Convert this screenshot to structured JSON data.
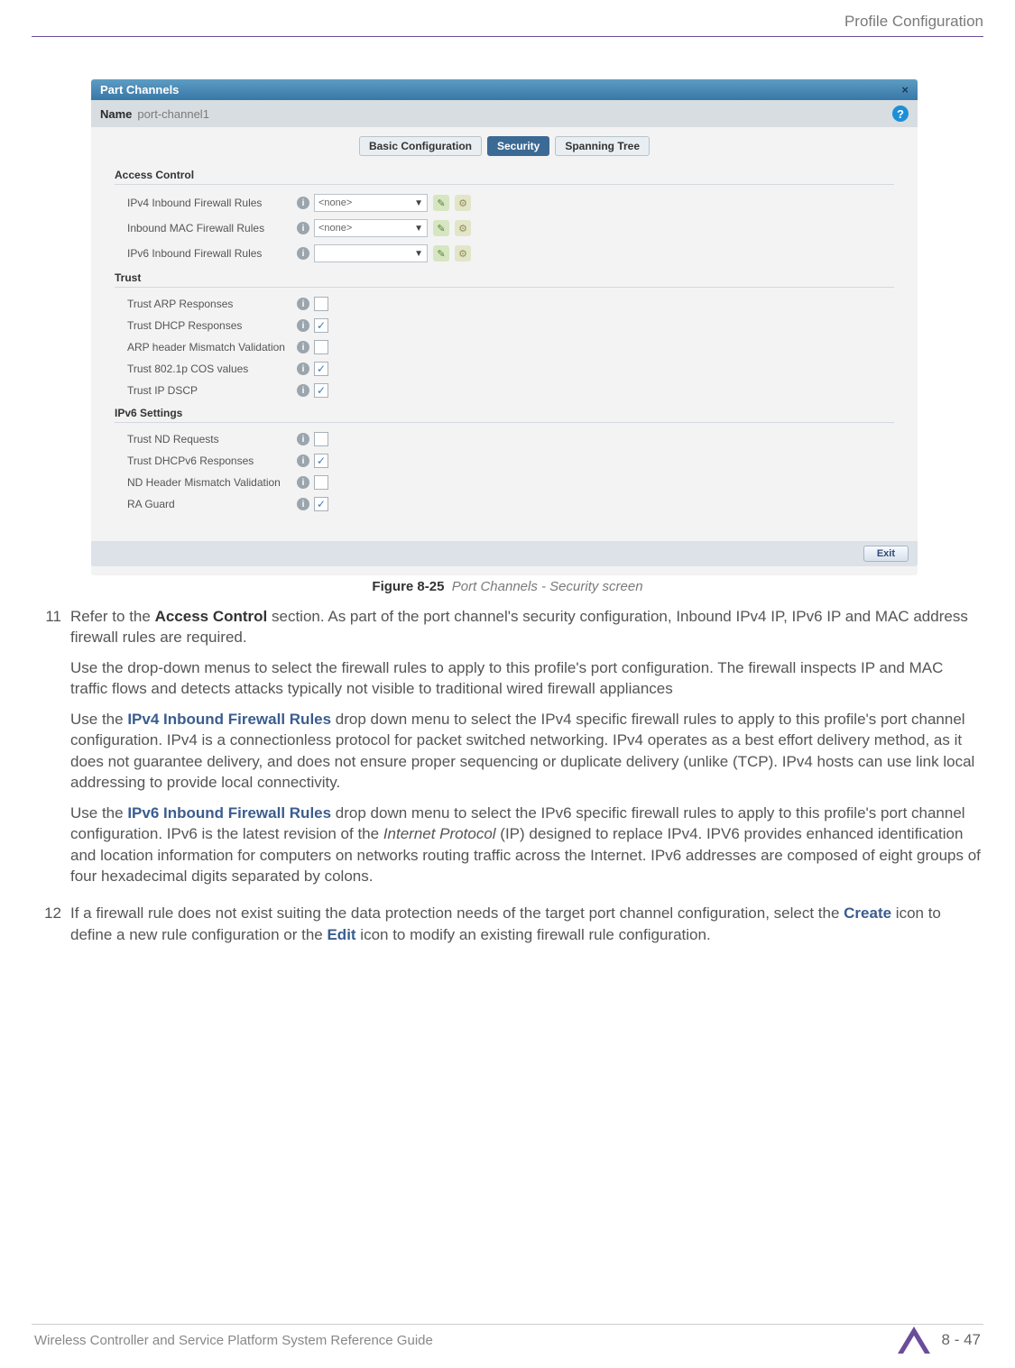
{
  "header": {
    "right": "Profile Configuration"
  },
  "screenshot": {
    "panel_title": "Part Channels",
    "name_label": "Name",
    "name_value": "port-channel1",
    "tabs": {
      "basic": "Basic Configuration",
      "security": "Security",
      "spanning": "Spanning Tree"
    },
    "sections": {
      "access_control": {
        "title": "Access Control",
        "rows": [
          {
            "label": "IPv4 Inbound Firewall Rules",
            "dd": "<none>"
          },
          {
            "label": "Inbound MAC Firewall Rules",
            "dd": "<none>"
          },
          {
            "label": "IPv6 Inbound Firewall Rules",
            "dd": ""
          }
        ]
      },
      "trust": {
        "title": "Trust",
        "rows": [
          {
            "label": "Trust ARP Responses",
            "checked": false
          },
          {
            "label": "Trust DHCP Responses",
            "checked": true
          },
          {
            "label": "ARP header Mismatch Validation",
            "checked": false
          },
          {
            "label": "Trust 802.1p COS values",
            "checked": true
          },
          {
            "label": "Trust IP DSCP",
            "checked": true
          }
        ]
      },
      "ipv6": {
        "title": "IPv6 Settings",
        "rows": [
          {
            "label": "Trust ND Requests",
            "checked": false
          },
          {
            "label": "Trust DHCPv6 Responses",
            "checked": true
          },
          {
            "label": "ND Header Mismatch Validation",
            "checked": false
          },
          {
            "label": "RA Guard",
            "checked": true
          }
        ]
      }
    },
    "exit": "Exit"
  },
  "caption": {
    "fig": "Figure 8-25",
    "text": "Port Channels - Security screen"
  },
  "list": {
    "n11": "11",
    "n12": "12",
    "p11a_pre": "Refer to the ",
    "p11a_bold": "Access Control",
    "p11a_post": " section. As part of the port channel's security configuration, Inbound IPv4 IP, IPv6 IP and MAC address firewall rules are required.",
    "p11b": "Use the drop-down menus to select the firewall rules to apply to this profile's port configuration. The firewall inspects IP and MAC traffic flows and detects attacks typically not visible to traditional wired firewall appliances",
    "p11c_pre": "Use the ",
    "p11c_bold": "IPv4 Inbound Firewall Rules",
    "p11c_post": " drop down menu to select the IPv4 specific firewall rules to apply to this profile's port channel configuration. IPv4 is a connectionless protocol for packet switched networking. IPv4 operates as a best effort delivery method, as it does not guarantee delivery, and does not ensure proper sequencing or duplicate delivery (unlike (TCP). IPv4 hosts can use link local addressing to provide local connectivity.",
    "p11d_pre": "Use the ",
    "p11d_bold": "IPv6 Inbound Firewall Rules",
    "p11d_mid": " drop down menu to select the IPv6 specific firewall rules to apply to this profile's port channel configuration. IPv6 is the latest revision of the ",
    "p11d_it": "Internet Protocol",
    "p11d_post": " (IP) designed to replace IPv4. IPV6 provides enhanced identification and location information for computers on networks routing traffic across the Internet. IPv6 addresses are composed of eight groups of four hexadecimal digits separated by colons.",
    "p12_pre": "If a firewall rule does not exist suiting the data protection needs of the target port channel configuration, select the ",
    "p12_b1": "Create",
    "p12_mid": " icon to define a new rule configuration or the ",
    "p12_b2": "Edit",
    "p12_post": " icon to modify an existing firewall rule configuration."
  },
  "footer": {
    "left": "Wireless Controller and Service Platform System Reference Guide",
    "right": "8 - 47"
  }
}
